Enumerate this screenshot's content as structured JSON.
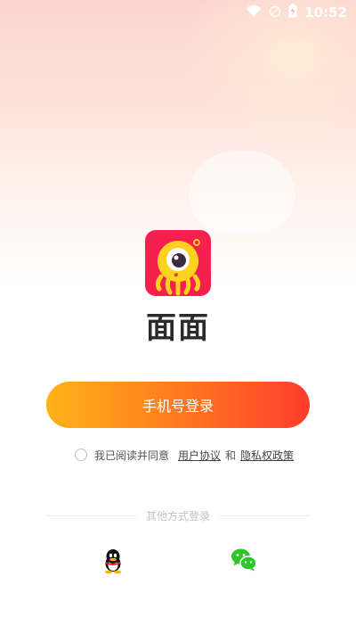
{
  "status_bar": {
    "time": "10:52",
    "icons": [
      "wifi-icon",
      "no-sim-icon",
      "battery-charging-icon"
    ]
  },
  "app": {
    "name": "面面",
    "logo_icon": "one-eyed-yellow-monster-logo"
  },
  "login": {
    "phone_button_label": "手机号登录"
  },
  "agreement": {
    "prefix": "我已阅读并同意",
    "user_agreement": "用户协议",
    "conjunction": "和",
    "privacy_policy": "隐私权政策"
  },
  "other_login": {
    "label": "其他方式登录",
    "options": [
      "qq-icon",
      "wechat-icon"
    ]
  },
  "colors": {
    "button_gradient_start": "#ffb31a",
    "button_gradient_end": "#ff3d2e",
    "logo_bg": "#f5204e",
    "wechat_green": "#2fc42c"
  }
}
